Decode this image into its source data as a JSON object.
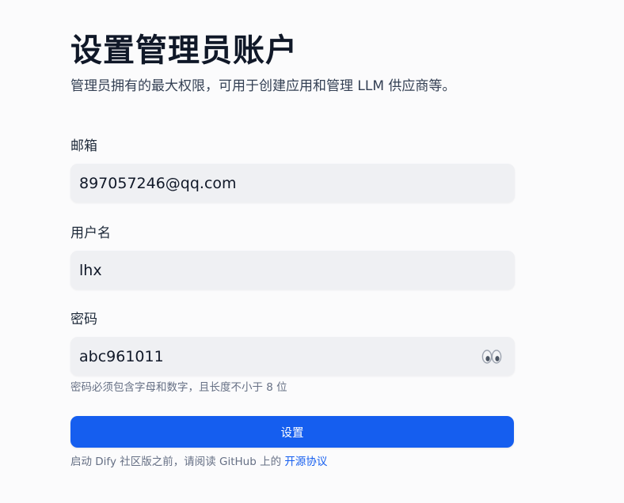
{
  "header": {
    "title": "设置管理员账户",
    "subtitle": "管理员拥有的最大权限，可用于创建应用和管理 LLM 供应商等。"
  },
  "form": {
    "email": {
      "label": "邮箱",
      "value": "897057246@qq.com"
    },
    "username": {
      "label": "用户名",
      "value": "lhx"
    },
    "password": {
      "label": "密码",
      "value": "abc961011",
      "toggle_icon": "eyes-icon",
      "hint": "密码必须包含字母和数字，且长度不小于 8 位"
    },
    "submit_label": "设置"
  },
  "footer": {
    "prefix": "启动 Dify 社区版之前，请阅读 GitHub 上的 ",
    "link_label": "开源协议"
  },
  "colors": {
    "accent": "#155eef",
    "input_bg": "#eff0f3",
    "page_bg": "#fbfbfc"
  }
}
